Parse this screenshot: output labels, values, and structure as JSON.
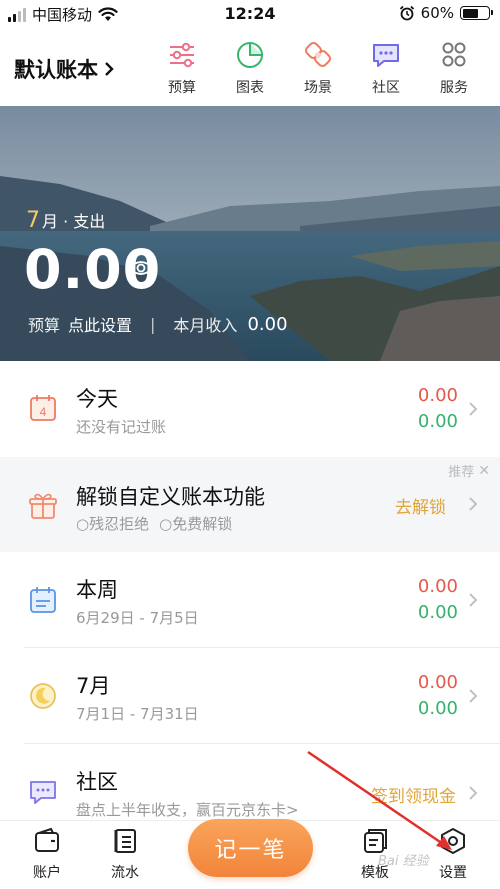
{
  "status_bar": {
    "carrier": "中国移动",
    "time": "12:24",
    "battery": "60%",
    "battery_level": 0.6
  },
  "header": {
    "book_title": "默认账本",
    "nav": [
      {
        "label": "预算",
        "icon": "budget-sliders-icon"
      },
      {
        "label": "图表",
        "icon": "pie-chart-icon"
      },
      {
        "label": "场景",
        "icon": "scene-icon"
      },
      {
        "label": "社区",
        "icon": "community-chat-icon"
      },
      {
        "label": "服务",
        "icon": "services-grid-icon"
      }
    ]
  },
  "banner": {
    "month": "7",
    "month_suffix": "月 · 支出",
    "expense": "0.00",
    "budget_label": "预算",
    "budget_value": "点此设置",
    "income_label": "本月收入",
    "income_value": "0.00"
  },
  "list": {
    "today": {
      "title": "今天",
      "sub": "还没有记过账",
      "expense": "0.00",
      "income": "0.00",
      "icon_text": "4"
    },
    "promo": {
      "title": "解锁自定义账本功能",
      "opt1": "残忍拒绝",
      "opt2": "免费解锁",
      "action": "去解锁",
      "tag": "推荐"
    },
    "week": {
      "title": "本周",
      "sub": "6月29日 - 7月5日",
      "expense": "0.00",
      "income": "0.00"
    },
    "month": {
      "title": "7月",
      "sub": "7月1日 - 7月31日",
      "expense": "0.00",
      "income": "0.00"
    },
    "community": {
      "title": "社区",
      "sub": "盘点上半年收支，赢百元京东卡>",
      "action": "签到领现金"
    }
  },
  "tabbar": {
    "account": "账户",
    "flow": "流水",
    "record": "记一笔",
    "template": "模板",
    "settings": "设置"
  },
  "watermark": "Bai 经验",
  "colors": {
    "expense_red": "#e25a4c",
    "income_green": "#35b26d",
    "accent_orange": "#f2843b",
    "gold": "#dfa637"
  }
}
